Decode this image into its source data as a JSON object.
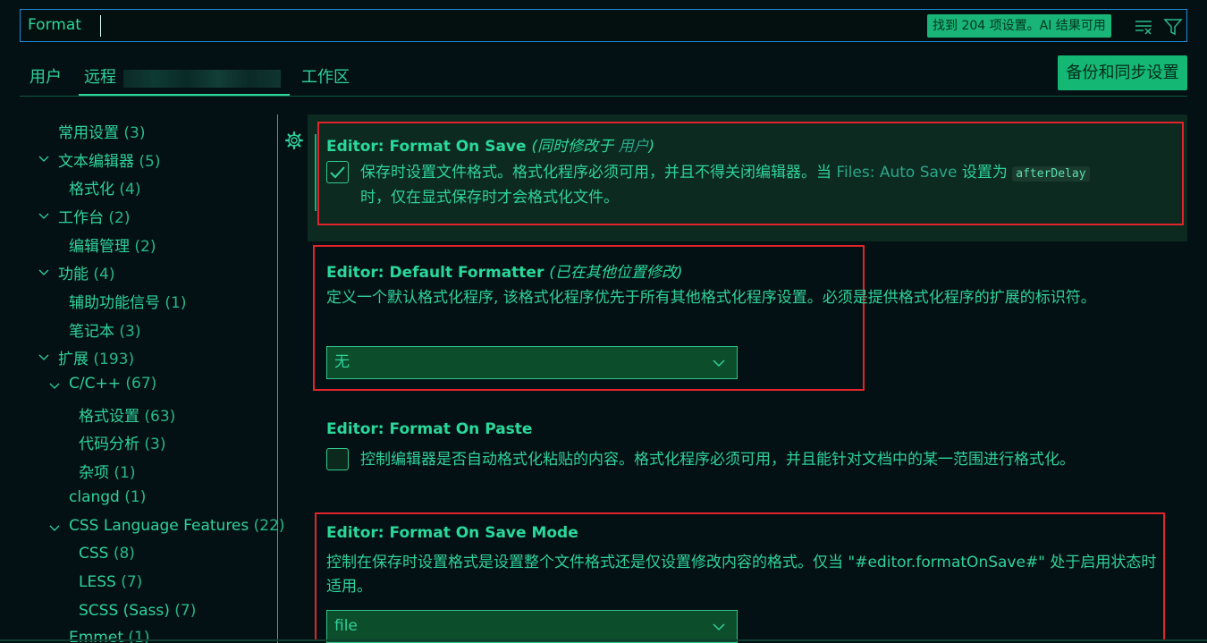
{
  "search": {
    "value": "Format",
    "result_badge": "找到 204 项设置。AI 结果可用"
  },
  "tabs": [
    {
      "label": "用户"
    },
    {
      "label": "远程"
    },
    {
      "label": "工作区"
    }
  ],
  "sync_button": "备份和同步设置",
  "tree": [
    {
      "label": "常用设置",
      "count": "(3)"
    },
    {
      "label": "文本编辑器",
      "count": "(5)"
    },
    {
      "label": "格式化",
      "count": "(4)"
    },
    {
      "label": "工作台",
      "count": "(2)"
    },
    {
      "label": "编辑管理",
      "count": "(2)"
    },
    {
      "label": "功能",
      "count": "(4)"
    },
    {
      "label": "辅助功能信号",
      "count": "(1)"
    },
    {
      "label": "笔记本",
      "count": "(3)"
    },
    {
      "label": "扩展",
      "count": "(193)"
    },
    {
      "label": "C/C++",
      "count": "(67)"
    },
    {
      "label": "格式设置",
      "count": "(63)"
    },
    {
      "label": "代码分析",
      "count": "(3)"
    },
    {
      "label": "杂项",
      "count": "(1)"
    },
    {
      "label": "clangd",
      "count": "(1)"
    },
    {
      "label": "CSS Language Features",
      "count": "(22)"
    },
    {
      "label": "CSS",
      "count": "(8)"
    },
    {
      "label": "LESS",
      "count": "(7)"
    },
    {
      "label": "SCSS (Sass)",
      "count": "(7)"
    },
    {
      "label": "Emmet",
      "count": "(1)"
    }
  ],
  "settings": {
    "format_on_save": {
      "category": "Editor: ",
      "name": "Format On Save",
      "modified_prefix": "(同时修改于 ",
      "modified_link": "用户",
      "modified_suffix": ")",
      "desc_1": "保存时设置文件格式。格式化程序必须可用，并且不得关闭编辑器。当 ",
      "desc_link": "Files: Auto Save",
      "desc_2": " 设置为 ",
      "desc_code": "afterDelay",
      "desc_3": "时，仅在显式保存时才会格式化文件。",
      "checked": true
    },
    "default_formatter": {
      "category": "Editor: ",
      "name": "Default Formatter",
      "modified": "(已在其他位置修改)",
      "desc": "定义一个默认格式化程序, 该格式化程序优先于所有其他格式化程序设置。必须是提供格式化程序的扩展的标识符。",
      "value": "无"
    },
    "format_on_paste": {
      "category": "Editor: ",
      "name": "Format On Paste",
      "desc": "控制编辑器是否自动格式化粘贴的内容。格式化程序必须可用，并且能针对文档中的某一范围进行格式化。",
      "checked": false
    },
    "format_on_save_mode": {
      "category": "Editor: ",
      "name": "Format On Save Mode",
      "desc": "控制在保存时设置格式是设置整个文件格式还是仅设置修改内容的格式。仅当 \"#editor.formatOnSave#\" 处于启用状态时适用。",
      "value": "file"
    }
  },
  "colors": {
    "background": "#041114",
    "accent": "#2fd29a",
    "button": "#14b774",
    "highlight_box": "#e0242c"
  }
}
